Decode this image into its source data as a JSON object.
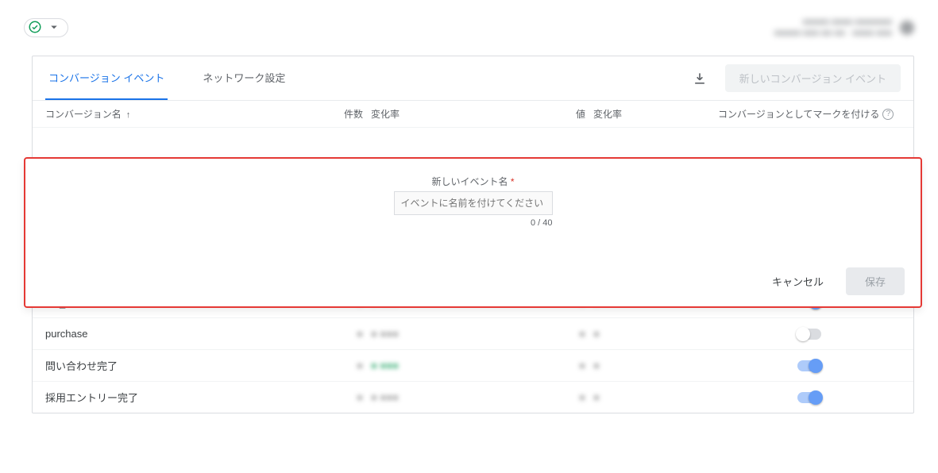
{
  "header": {
    "meta_line1": "■■■■■ ■■■■ ■■■■■■■",
    "meta_line2": "■■■■■ ■■■ ■■ ■■ - ■■■■ ■■■"
  },
  "tabs": {
    "conversion": "コンバージョン イベント",
    "network": "ネットワーク設定",
    "new_button": "新しいコンバージョン イベント"
  },
  "columns": {
    "name": "コンバージョン名",
    "count": "件数",
    "rate1": "変化率",
    "value": "値",
    "rate2": "変化率",
    "mark": "コンバージョンとしてマークを付ける"
  },
  "form": {
    "label": "新しいイベント名",
    "placeholder": "イベントに名前を付けてください",
    "counter": "0 / 40",
    "cancel": "キャンセル",
    "save": "保存"
  },
  "rows": [
    {
      "name": "CV_フォーム",
      "on": true,
      "green": false
    },
    {
      "name": "purchase",
      "on": false,
      "green": false
    },
    {
      "name": "問い合わせ完了",
      "on": true,
      "green": true
    },
    {
      "name": "採用エントリー完了",
      "on": true,
      "green": false
    }
  ]
}
